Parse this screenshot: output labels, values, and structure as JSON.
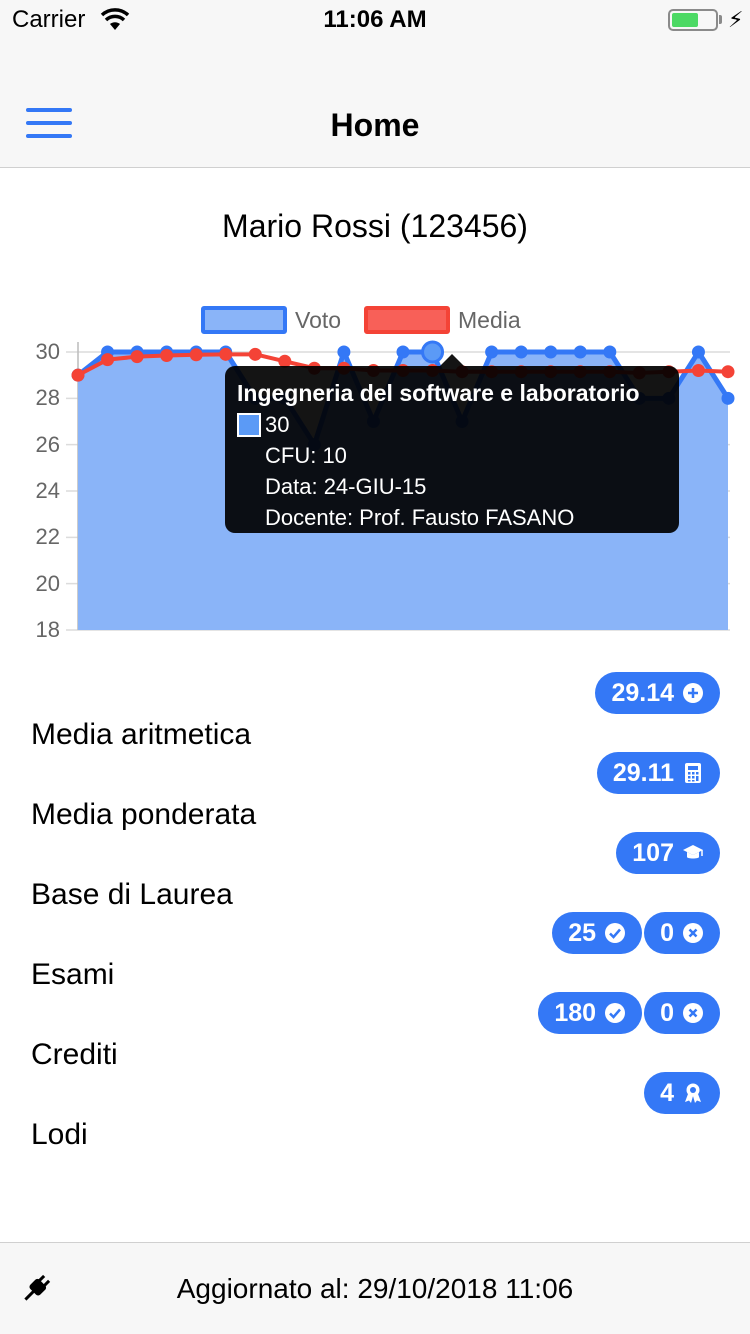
{
  "status_bar": {
    "carrier": "Carrier",
    "time": "11:06 AM",
    "battery_level": 0.62,
    "charging": true
  },
  "navbar": {
    "title": "Home",
    "menu_icon": "hamburger-menu-icon"
  },
  "student": {
    "name": "Mario Rossi (123456)"
  },
  "chart_data": {
    "type": "line",
    "legend": [
      "Voto",
      "Media"
    ],
    "ylim": [
      18,
      30
    ],
    "yticks": [
      30,
      28,
      26,
      24,
      22,
      20,
      18
    ],
    "grid": true,
    "legend_position": "top",
    "series": [
      {
        "name": "Voto",
        "color": "#3478f6",
        "fill": "#8ab4f8",
        "values": [
          29,
          30,
          30,
          30,
          30,
          30,
          28,
          28,
          26,
          30,
          27,
          30,
          30,
          27,
          30,
          30,
          30,
          30,
          30,
          28,
          28,
          30,
          28
        ]
      },
      {
        "name": "Media",
        "color": "#f44336",
        "values": [
          29,
          29.67,
          29.8,
          29.85,
          29.88,
          29.9,
          29.9,
          29.6,
          29.3,
          29.3,
          29.2,
          29.2,
          29.2,
          29.15,
          29.15,
          29.15,
          29.15,
          29.15,
          29.15,
          29.1,
          29.15,
          29.2,
          29.15
        ]
      }
    ],
    "highlight_index": 12,
    "tooltip": {
      "title": "Ingegneria del software e laboratorio",
      "value": "30",
      "cfu": "CFU: 10",
      "date": "Data: 24-GIU-15",
      "teacher": "Docente: Prof. Fausto FASANO"
    }
  },
  "stats": {
    "media_aritmetica": {
      "label": "Media aritmetica",
      "value": "29.14",
      "icon": "plus-circle-icon"
    },
    "media_ponderata": {
      "label": "Media ponderata",
      "value": "29.11",
      "icon": "calculator-icon"
    },
    "base_laurea": {
      "label": "Base di Laurea",
      "value": "107",
      "icon": "graduation-cap-icon"
    },
    "esami": {
      "label": "Esami",
      "passed": "25",
      "failed": "0",
      "icons": [
        "check-circle-icon",
        "x-circle-icon"
      ]
    },
    "crediti": {
      "label": "Crediti",
      "passed": "180",
      "failed": "0",
      "icons": [
        "check-circle-icon",
        "x-circle-icon"
      ]
    },
    "lodi": {
      "label": "Lodi",
      "value": "4",
      "icon": "award-ribbon-icon"
    }
  },
  "footer": {
    "updated": "Aggiornato al: 29/10/2018 11:06",
    "icon": "plug-icon"
  }
}
